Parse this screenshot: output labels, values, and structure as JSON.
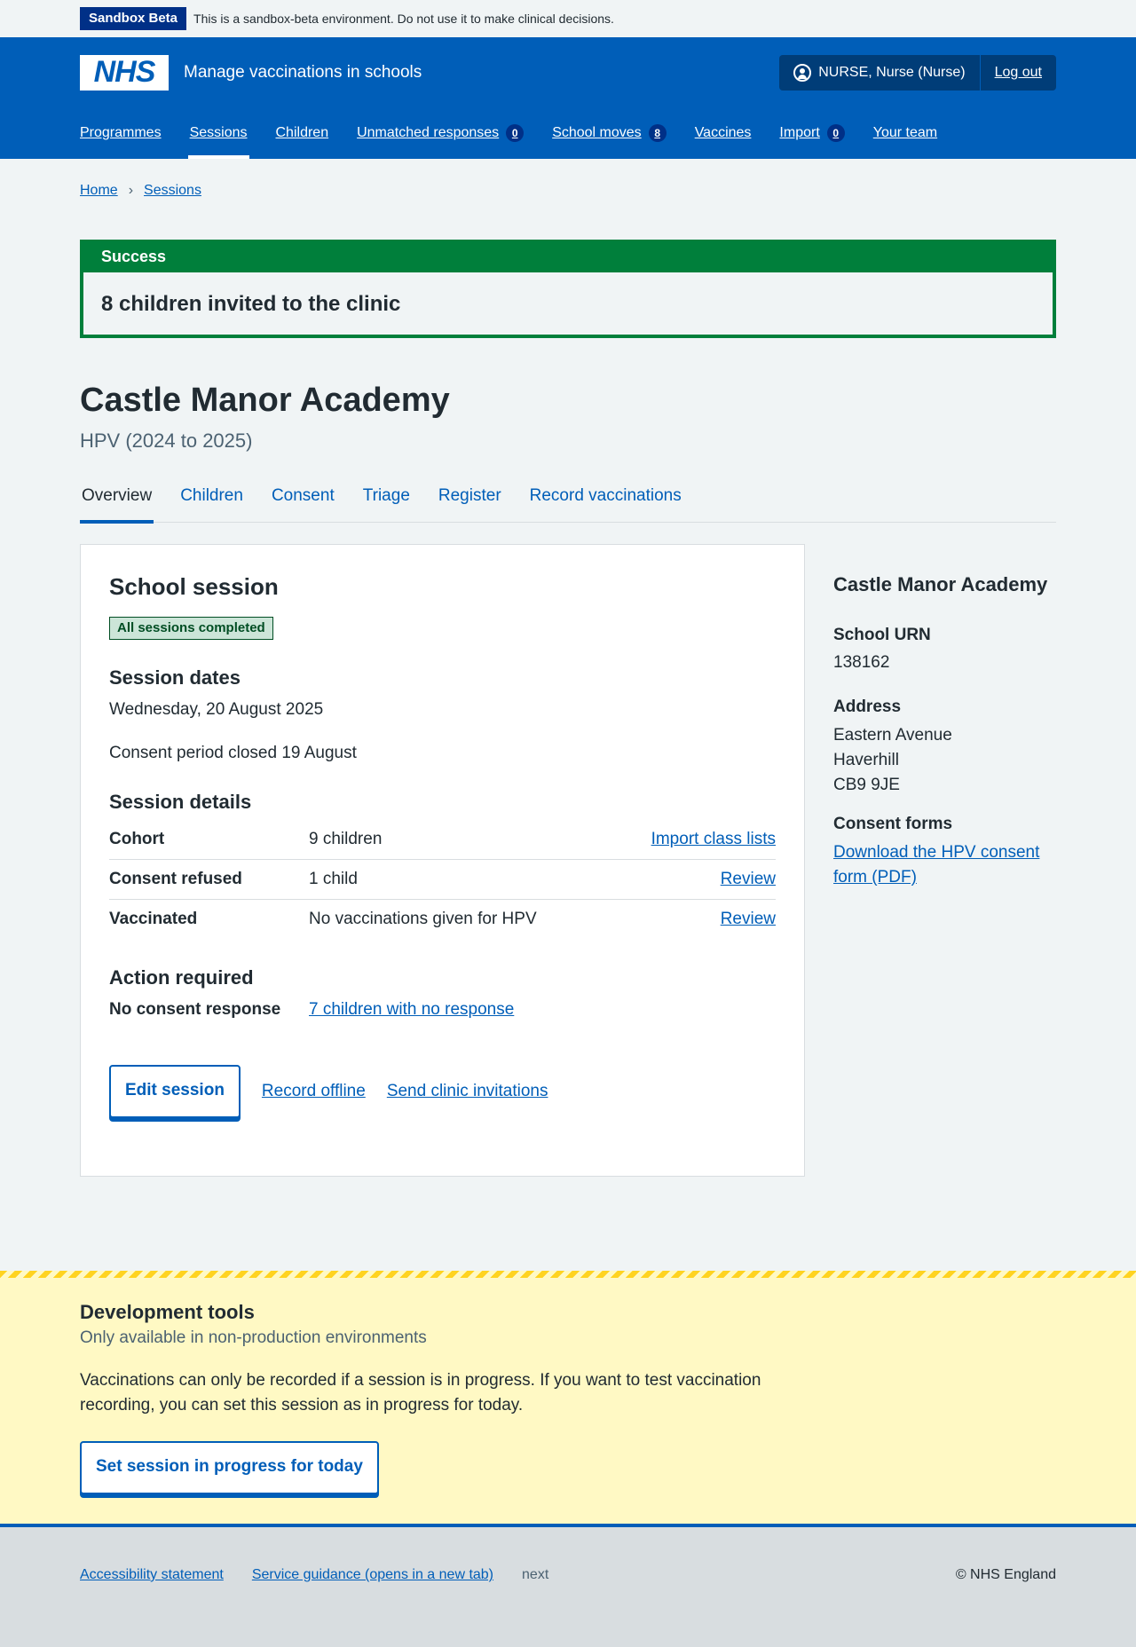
{
  "sandbox": {
    "tag": "Sandbox Beta",
    "text": "This is a sandbox-beta environment. Do not use it to make clinical decisions."
  },
  "header": {
    "logo": "NHS",
    "service_name": "Manage vaccinations in schools",
    "user": "NURSE, Nurse (Nurse)",
    "logout": "Log out",
    "nav": [
      {
        "label": "Programmes"
      },
      {
        "label": "Sessions",
        "active": true
      },
      {
        "label": "Children"
      },
      {
        "label": "Unmatched responses",
        "count": "0"
      },
      {
        "label": "School moves",
        "count": "8"
      },
      {
        "label": "Vaccines"
      },
      {
        "label": "Import",
        "count": "0"
      },
      {
        "label": "Your team"
      }
    ]
  },
  "breadcrumb": {
    "home": "Home",
    "sessions": "Sessions"
  },
  "success": {
    "heading": "Success",
    "message": "8 children invited to the clinic"
  },
  "page": {
    "title": "Castle Manor Academy",
    "caption": "HPV (2024 to 2025)"
  },
  "tabs": [
    "Overview",
    "Children",
    "Consent",
    "Triage",
    "Register",
    "Record vaccinations"
  ],
  "card": {
    "title": "School session",
    "status_tag": "All sessions completed",
    "dates_heading": "Session dates",
    "date": "Wednesday, 20 August 2025",
    "consent_period": "Consent period closed 19 August",
    "details_heading": "Session details",
    "details": [
      {
        "key": "Cohort",
        "value": "9 children",
        "action": "Import class lists"
      },
      {
        "key": "Consent refused",
        "value": "1 child",
        "action": "Review"
      },
      {
        "key": "Vaccinated",
        "value": "No vaccinations given for HPV",
        "action": "Review"
      }
    ],
    "action_heading": "Action required",
    "action_key": "No consent response",
    "action_link": "7 children with no response",
    "edit_button": "Edit session",
    "record_offline": "Record offline",
    "send_invitations": "Send clinic invitations"
  },
  "side": {
    "title": "Castle Manor Academy",
    "urn_label": "School URN",
    "urn": "138162",
    "address_label": "Address",
    "address": [
      "Eastern Avenue",
      "Haverhill",
      "CB9 9JE"
    ],
    "forms_label": "Consent forms",
    "forms_link": "Download the HPV consent form (PDF)"
  },
  "dev": {
    "title": "Development tools",
    "subtitle": "Only available in non-production environments",
    "text": "Vaccinations can only be recorded if a session is in progress. If you want to test vaccination recording, you can set this session as in progress for today.",
    "button": "Set session in progress for today"
  },
  "footer": {
    "accessibility": "Accessibility statement",
    "guidance": "Service guidance (opens in a new tab)",
    "next": "next",
    "copyright": "© NHS England"
  }
}
